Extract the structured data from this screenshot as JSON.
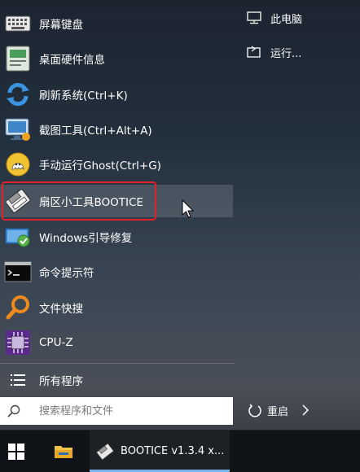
{
  "menu": {
    "items": [
      {
        "label": "屏幕键盘",
        "icon": "keyboard-icon"
      },
      {
        "label": "桌面硬件信息",
        "icon": "hardware-info-icon"
      },
      {
        "label": "刷新系统(Ctrl+K)",
        "icon": "refresh-icon"
      },
      {
        "label": "截图工具(Ctrl+Alt+A)",
        "icon": "screenshot-icon"
      },
      {
        "label": "手动运行Ghost(Ctrl+G)",
        "icon": "ghost-icon"
      },
      {
        "label": "扇区小工具BOOTICE",
        "icon": "bootice-icon"
      },
      {
        "label": "Windows引导修复",
        "icon": "boot-repair-icon"
      },
      {
        "label": "命令提示符",
        "icon": "cmd-icon"
      },
      {
        "label": "文件快搜",
        "icon": "file-search-icon"
      },
      {
        "label": "CPU-Z",
        "icon": "cpu-z-icon"
      }
    ],
    "all_programs": "所有程序",
    "search_placeholder": "搜索程序和文件"
  },
  "right": {
    "this_pc": "此电脑",
    "run": "运行...",
    "restart": "重启"
  },
  "taskbar": {
    "active_task": "BOOTICE v1.3.4 x..."
  },
  "colors": {
    "highlight_border": "#e0212a",
    "taskbar_accent": "#7ab2ea"
  }
}
